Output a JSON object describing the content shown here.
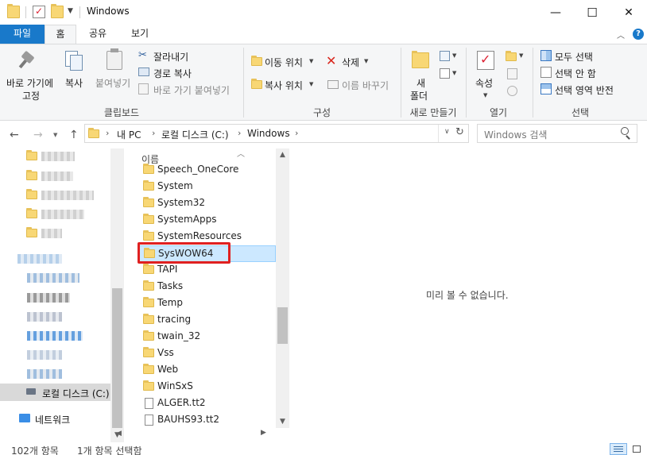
{
  "window": {
    "title": "Windows",
    "controls": {
      "minimize": "—",
      "maximize": "☐",
      "close": "✕"
    }
  },
  "ribbon_tabs": [
    {
      "label": "파일"
    },
    {
      "label": "홈"
    },
    {
      "label": "공유"
    },
    {
      "label": "보기"
    }
  ],
  "ribbon": {
    "clipboard": {
      "pin_label_line1": "바로 가기에",
      "pin_label_line2": "고정",
      "copy_label": "복사",
      "paste_label": "붙여넣기",
      "cut_label": "잘라내기",
      "copy_path_label": "경로 복사",
      "paste_shortcut_label": "바로 가기 붙여넣기",
      "group_label": "클립보드"
    },
    "organize": {
      "move_to_label": "이동 위치",
      "delete_label": "삭제",
      "copy_to_label": "복사 위치",
      "rename_label": "이름 바꾸기",
      "group_label": "구성"
    },
    "new": {
      "new_folder_line1": "새",
      "new_folder_line2": "폴더",
      "group_label": "새로 만들기"
    },
    "open": {
      "properties_label": "속성",
      "group_label": "열기"
    },
    "select": {
      "select_all_label": "모두 선택",
      "select_none_label": "선택 안 함",
      "invert_label": "선택 영역 반전",
      "group_label": "선택"
    }
  },
  "address": {
    "segments": [
      "내 PC",
      "로컬 디스크 (C:)",
      "Windows"
    ],
    "search_placeholder": "Windows 검색"
  },
  "navpane": {
    "local_disk_label": "로컬 디스크 (C:)",
    "network_label": "네트워크"
  },
  "filelist": {
    "column_header": "이름",
    "items": [
      {
        "name": "Speech_OneCore",
        "type": "folder"
      },
      {
        "name": "System",
        "type": "folder"
      },
      {
        "name": "System32",
        "type": "folder"
      },
      {
        "name": "SystemApps",
        "type": "folder"
      },
      {
        "name": "SystemResources",
        "type": "folder"
      },
      {
        "name": "SysWOW64",
        "type": "folder",
        "selected": true
      },
      {
        "name": "TAPI",
        "type": "folder"
      },
      {
        "name": "Tasks",
        "type": "folder"
      },
      {
        "name": "Temp",
        "type": "folder"
      },
      {
        "name": "tracing",
        "type": "folder"
      },
      {
        "name": "twain_32",
        "type": "folder"
      },
      {
        "name": "Vss",
        "type": "folder"
      },
      {
        "name": "Web",
        "type": "folder"
      },
      {
        "name": "WinSxS",
        "type": "folder"
      },
      {
        "name": "ALGER.tt2",
        "type": "file"
      },
      {
        "name": "BAUHS93.tt2",
        "type": "file"
      }
    ]
  },
  "preview_text": "미리 볼 수 없습니다.",
  "status": {
    "item_count": "102개 항목",
    "selected_count": "1개 항목 선택함"
  },
  "colors": {
    "file_tab": "#1979ca",
    "selection": "#cce8ff",
    "highlight_box": "#e02020",
    "folder": "#f8d775"
  }
}
